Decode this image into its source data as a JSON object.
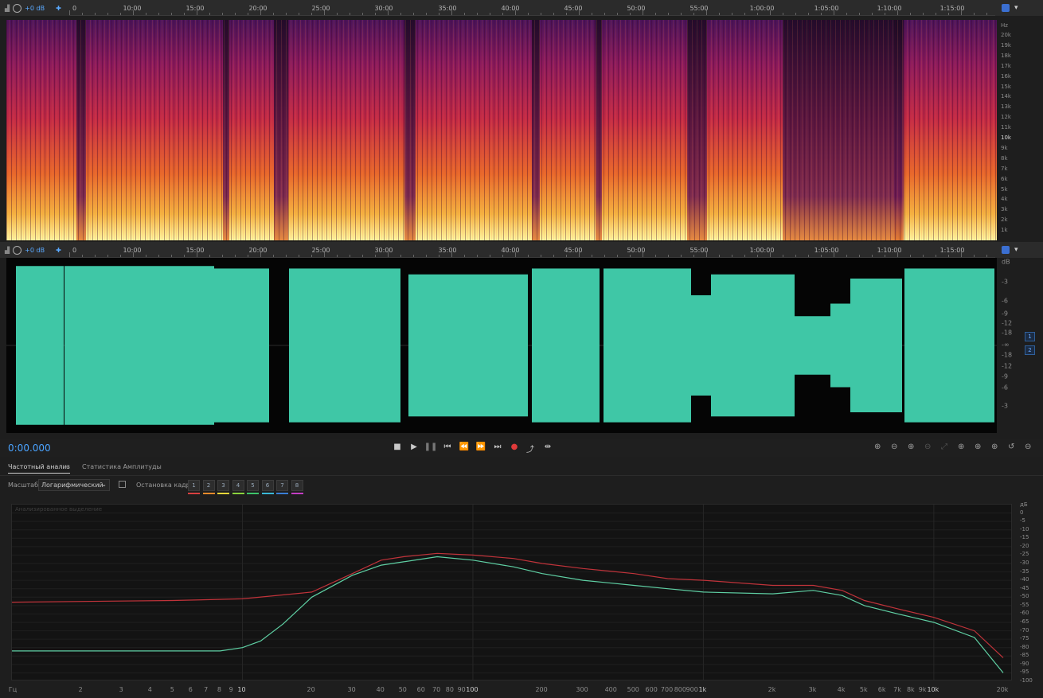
{
  "top_header": {
    "gain_label": "+0 dB",
    "pin_icon": "pin-icon",
    "zoom_icon": "zoom-track-icon"
  },
  "timeline": {
    "labels": [
      "0",
      "10:00",
      "15:00",
      "20:00",
      "25:00",
      "30:00",
      "35:00",
      "40:00",
      "45:00",
      "50:00",
      "55:00",
      "1:00:00",
      "1:05:00",
      "1:10:00",
      "1:15:00"
    ]
  },
  "spectral": {
    "unit_label": "Hz",
    "freq_labels": [
      "20k",
      "19k",
      "18k",
      "17k",
      "16k",
      "15k",
      "14k",
      "13k",
      "12k",
      "11k",
      "10k",
      "9k",
      "8k",
      "7k",
      "6k",
      "5k",
      "4k",
      "3k",
      "2k",
      "1k"
    ],
    "highlight_label": "10k"
  },
  "waveform": {
    "unit_label": "dB",
    "db_labels_top": [
      "-3",
      "-6",
      "-9",
      "-12",
      "-18"
    ],
    "infinity_label": "-∞",
    "db_labels_bottom": [
      "-18",
      "-12",
      "-9",
      "-6",
      "-3"
    ],
    "channel_1": "1",
    "channel_2": "2",
    "color": "#3fc7a6"
  },
  "transport": {
    "time_display": "0:00.000",
    "buttons": [
      "stop-icon",
      "play-icon",
      "pause-icon",
      "go-start-icon",
      "rewind-icon",
      "fast-forward-icon",
      "go-end-icon",
      "record-icon",
      "loop-icon",
      "skip-selection-icon"
    ],
    "record_color": "#e03a3a"
  },
  "panel": {
    "tab_frequency": "Частотный анализ",
    "tab_amplitude": "Статистика Амплитуды",
    "scale_label": "Масштаб:",
    "scale_value": "Логарифмический",
    "freeze_label": "Остановка кадра:",
    "frames": [
      {
        "label": "1",
        "color": "#d94040"
      },
      {
        "label": "2",
        "color": "#e88a2b"
      },
      {
        "label": "3",
        "color": "#e6d63a"
      },
      {
        "label": "4",
        "color": "#8ad23d"
      },
      {
        "label": "5",
        "color": "#3dc46a"
      },
      {
        "label": "6",
        "color": "#3ab8d6"
      },
      {
        "label": "7",
        "color": "#3a7ed6"
      },
      {
        "label": "8",
        "color": "#c43dc4"
      }
    ]
  },
  "graph": {
    "overlay_label": "Анализированное выделение",
    "x_unit": "Гц",
    "y_unit": "дБ",
    "x_labels": [
      "2",
      "3",
      "4",
      "5",
      "6",
      "7",
      "8",
      "9",
      "10",
      "20",
      "30",
      "40",
      "50",
      "60",
      "70",
      "80",
      "90",
      "100",
      "200",
      "300",
      "400",
      "500",
      "600",
      "700",
      "800",
      "900",
      "1k",
      "2k",
      "3k",
      "4k",
      "5k",
      "6k",
      "7k",
      "8k",
      "9k",
      "10k",
      "20k"
    ],
    "y_labels": [
      "0",
      "-5",
      "-10",
      "-15",
      "-20",
      "-25",
      "-30",
      "-35",
      "-40",
      "-45",
      "-50",
      "-55",
      "-60",
      "-65",
      "-70",
      "-75",
      "-80",
      "-85",
      "-90",
      "-95",
      "-100"
    ]
  },
  "chart_data": {
    "type": "line",
    "xlabel": "Гц",
    "ylabel": "дБ",
    "x_scale": "log",
    "xlim": [
      1,
      22000
    ],
    "ylim": [
      -100,
      5
    ],
    "grid": true,
    "series": [
      {
        "color": "#c0333a",
        "x": [
          1,
          5,
          10,
          20,
          30,
          40,
          50,
          70,
          100,
          150,
          200,
          300,
          500,
          700,
          1000,
          2000,
          3000,
          4000,
          5000,
          7000,
          10000,
          15000,
          20000
        ],
        "y": [
          -53,
          -52,
          -51,
          -47,
          -36,
          -28,
          -26,
          -24,
          -25,
          -27,
          -30,
          -33,
          -36,
          -39,
          -40,
          -43,
          -43,
          -46,
          -52,
          -57,
          -62,
          -70,
          -86
        ]
      },
      {
        "color": "#5fd0a4",
        "x": [
          1,
          5,
          8,
          10,
          12,
          15,
          20,
          30,
          40,
          50,
          70,
          100,
          150,
          200,
          300,
          500,
          700,
          1000,
          2000,
          3000,
          4000,
          5000,
          7000,
          10000,
          15000,
          20000
        ],
        "y": [
          -82,
          -82,
          -82,
          -80,
          -76,
          -66,
          -50,
          -37,
          -31,
          -29,
          -26,
          -28,
          -32,
          -36,
          -40,
          -43,
          -45,
          -47,
          -48,
          -46,
          -49,
          -55,
          -60,
          -65,
          -74,
          -95
        ]
      }
    ]
  }
}
